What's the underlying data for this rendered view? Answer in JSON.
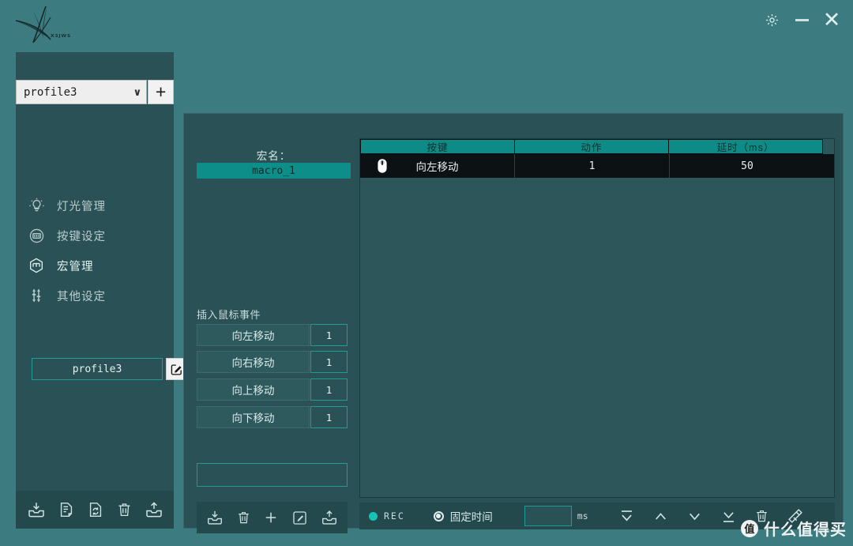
{
  "window": {
    "logo_text": "X3JWS",
    "controls": {
      "settings": "settings-gear",
      "minimize": "minimize",
      "close": "✕"
    }
  },
  "sidebar": {
    "profile_select": {
      "value": "profile3",
      "chevron": "∨",
      "add_label": "+"
    },
    "nav_items": [
      {
        "label": "灯光管理",
        "icon": "lightbulb-icon",
        "active": false
      },
      {
        "label": "按键设定",
        "icon": "keycap-icon",
        "active": false
      },
      {
        "label": "宏管理",
        "icon": "cube-icon",
        "active": true
      },
      {
        "label": "其他设定",
        "icon": "sliders-icon",
        "active": false
      }
    ],
    "current_profile": "profile3",
    "toolbar": [
      {
        "name": "import-profile-button",
        "icon": "import-tray-icon"
      },
      {
        "name": "edit-document-button",
        "icon": "document-edit-icon"
      },
      {
        "name": "sync-document-button",
        "icon": "document-refresh-icon"
      },
      {
        "name": "delete-profile-button",
        "icon": "trash-icon"
      },
      {
        "name": "export-profile-button",
        "icon": "export-tray-icon"
      }
    ]
  },
  "macro_panel": {
    "name_label": "宏名：",
    "name_value": "macro_1",
    "mouse_events_label": "插入鼠标事件",
    "mouse_events": [
      {
        "label": "向左移动",
        "value": "1"
      },
      {
        "label": "向右移动",
        "value": "1"
      },
      {
        "label": "向上移动",
        "value": "1"
      },
      {
        "label": "向下移动",
        "value": "1"
      }
    ],
    "text_input_value": "",
    "toolbar": [
      {
        "name": "import-macro-button",
        "icon": "import-tray-icon"
      },
      {
        "name": "delete-macro-button",
        "icon": "trash-icon"
      },
      {
        "name": "add-macro-button",
        "icon": "plus-icon"
      },
      {
        "name": "rename-macro-button",
        "icon": "pencil-square-icon"
      },
      {
        "name": "export-macro-button",
        "icon": "export-tray-icon"
      }
    ]
  },
  "table": {
    "headers": [
      "按键",
      "动作",
      "延时（ms）"
    ],
    "rows": [
      {
        "icon": "mouse-icon",
        "key": "向左移动",
        "action": "1",
        "delay": "50"
      }
    ]
  },
  "bottom_bar": {
    "rec_label": "REC",
    "fixed_time_label": "固定时间",
    "fixed_time_checked": true,
    "ms_value": "",
    "ms_unit": "ms",
    "nav_icons": [
      {
        "name": "move-to-top-button",
        "icon": "move-top-icon"
      },
      {
        "name": "move-up-button",
        "icon": "chevron-up-icon"
      },
      {
        "name": "move-down-button",
        "icon": "chevron-down-icon"
      },
      {
        "name": "move-to-bottom-button",
        "icon": "move-bottom-icon"
      },
      {
        "name": "delete-step-button",
        "icon": "trash-icon"
      },
      {
        "name": "clear-all-button",
        "icon": "eraser-icon"
      }
    ]
  },
  "watermark": {
    "badge": "值",
    "text": "什么值得买"
  },
  "colors": {
    "window_bg": "#3c7b80",
    "panel_bg": "#2a5155",
    "toolbar_bg": "#24494d",
    "accent": "#0e8b86",
    "accent_border": "#1e9c95",
    "table_row_bg": "#0c1113",
    "rec_dot": "#13c3b8"
  }
}
